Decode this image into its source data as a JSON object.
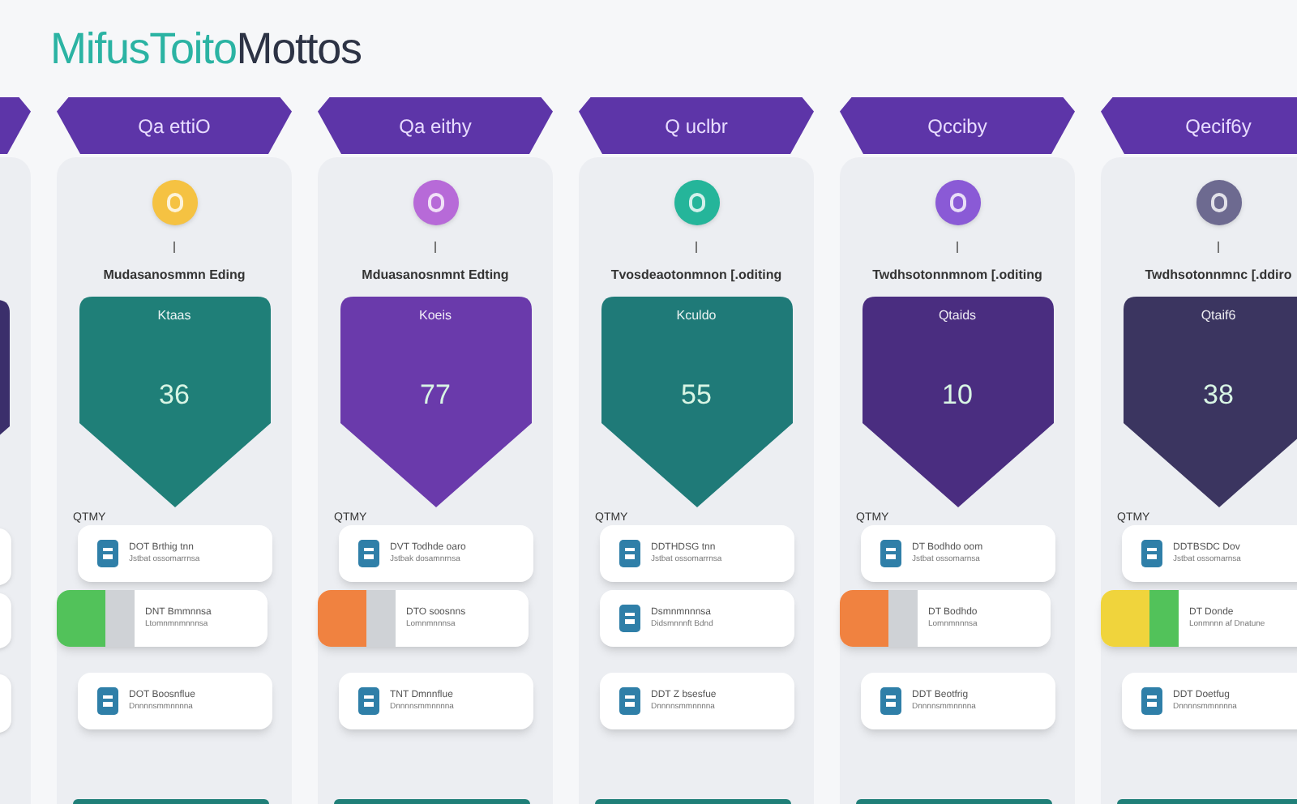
{
  "title": {
    "accent": "MifusToito",
    "rest": "Mottos"
  },
  "columns": [
    {
      "kind": "edge",
      "color": "#3b2f6b"
    },
    {
      "kind": "full",
      "header": "Qa ettiO",
      "icon": {
        "color": "#f5c242"
      },
      "caption": "Mudasanosmmn Eding",
      "color": "#1f7f78",
      "shield_label": "Ktaas",
      "value": "36",
      "tag": "QTMY",
      "cards": [
        {
          "kind": "icon",
          "line1": "DOT Brthig  tnn",
          "line2": "Jstbat ossomarrnsa"
        },
        {
          "kind": "swatch",
          "swatches": [
            {
              "color": "#52c25a"
            },
            {
              "color": "#cfd2d6"
            }
          ],
          "line1": "DNT Bmmnnsa",
          "line2": "Ltomnmnmnnnsa"
        },
        {
          "kind": "icon",
          "line1": "DOT Boosnflue",
          "line2": "Dnnnnsmmnnnna"
        }
      ]
    },
    {
      "kind": "full",
      "header": "Qa eithy",
      "icon": {
        "color": "#b76ad8"
      },
      "caption": "Mduasanosnmnt Edting",
      "color": "#6a3aab",
      "shield_label": "Koeis",
      "value": "77",
      "tag": "QTMY",
      "cards": [
        {
          "kind": "icon",
          "line1": "DVT Todhde  oaro",
          "line2": "Jstbak dosamnrnsa"
        },
        {
          "kind": "swatch",
          "swatches": [
            {
              "color": "#f08240"
            },
            {
              "color": "#cfd2d6"
            }
          ],
          "line1": "DTO soosnns",
          "line2": "Lomnmnnnsa"
        },
        {
          "kind": "icon",
          "line1": "TNT Dmnnflue",
          "line2": "Dnnnnsmmnnnna"
        }
      ]
    },
    {
      "kind": "full",
      "header": "Q uclbr",
      "icon": {
        "color": "#25b59a"
      },
      "caption": "Tvosdeaotonmnon [.oditing",
      "color": "#1f7a78",
      "shield_label": "Kculdo",
      "value": "55",
      "tag": "QTMY",
      "cards": [
        {
          "kind": "icon",
          "line1": "DDTHDSG  tnn",
          "line2": "Jstbat ossomarrnsa"
        },
        {
          "kind": "icon",
          "line1": "Dsmnmnnnsa",
          "line2": "Didsmnnnft Bdnd"
        },
        {
          "kind": "icon",
          "line1": "DDT Z bsesfue",
          "line2": "Dnnnnsmmnnnna"
        }
      ]
    },
    {
      "kind": "full",
      "header": "Qcciby",
      "icon": {
        "color": "#8a5ad6"
      },
      "caption": "Twdhsotonnmnom [.oditing",
      "color": "#4a2d80",
      "shield_label": "Qtaids",
      "value": "10",
      "tag": "QTMY",
      "cards": [
        {
          "kind": "icon",
          "line1": "DT Bodhdo  oom",
          "line2": "Jstbat ossomarnsa"
        },
        {
          "kind": "swatch",
          "swatches": [
            {
              "color": "#f08240"
            },
            {
              "color": "#cfd2d6"
            }
          ],
          "line1": "DT Bodhdo",
          "line2": "Lomnmnnnsa"
        },
        {
          "kind": "icon",
          "line1": "DDT Beotfrig",
          "line2": "Dnnnnsmmnnnna"
        }
      ]
    },
    {
      "kind": "full",
      "header": "Qecif6y",
      "icon": {
        "color": "#6d6a90"
      },
      "caption": "Twdhsotonnmnc [.ddiro",
      "color": "#3b3560",
      "shield_label": "Qtaif6",
      "value": "38",
      "tag": "QTMY",
      "cards": [
        {
          "kind": "icon",
          "line1": "DDTBSDC  Dov",
          "line2": "Jstbat ossomarnsa"
        },
        {
          "kind": "swatch",
          "swatches": [
            {
              "color": "#f0d43c"
            },
            {
              "color": "#52c25a"
            }
          ],
          "line1": "DT Donde",
          "line2": "Lonmnnn af Dnatune"
        },
        {
          "kind": "icon",
          "line1": "DDT Doetfug",
          "line2": "Dnnnnsmmnnnna"
        }
      ]
    }
  ]
}
